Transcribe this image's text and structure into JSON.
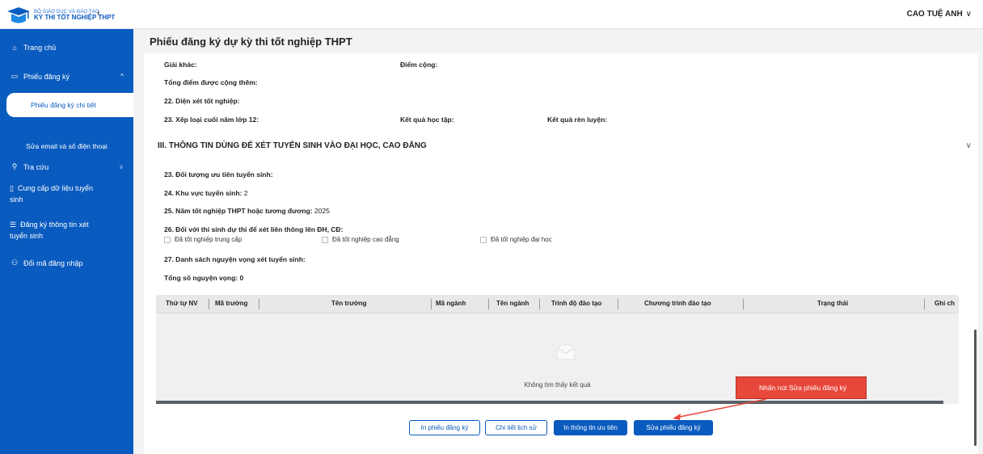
{
  "header": {
    "org_line": "BỘ GIÁO DỤC VÀ ĐÀO TẠO",
    "app_name": "KỲ THI TỐT NGHIỆP THPT",
    "collapse_glyph": "‹",
    "user_name": "CAO TUỆ ANH",
    "user_chevron": "∨"
  },
  "sidebar": {
    "home": {
      "icon": "⌂",
      "label": "Trang chủ"
    },
    "registration": {
      "icon": "▭",
      "label": "Phiếu đăng ký",
      "caret": "^"
    },
    "registration_detail": "Phiếu đăng ký chi tiết",
    "edit_contact": "Sửa email và số điện thoại",
    "lookup": {
      "icon": "⚲",
      "label": "Tra cứu",
      "caret": "∨"
    },
    "provide_data": {
      "icon": "▯",
      "label_1": "Cung cấp dữ liệu tuyển",
      "label_2": "sinh"
    },
    "register_info": {
      "icon": "☰",
      "label_1": "Đăng ký thông tin xét",
      "label_2": "tuyển sinh"
    },
    "change_code": {
      "icon": "⚇",
      "label": "Đổi mã đăng nhập"
    }
  },
  "main": {
    "title": "Phiếu đăng ký dự kỳ thi tốt nghiệp THPT",
    "fields": {
      "other_award": "Giải khác:",
      "bonus": "Điểm cộng:",
      "total_bonus": "Tổng điểm được cộng thêm:",
      "graduation_type": "22. Diện xét tốt nghiệp:",
      "grade12": "23. Xếp loại cuối năm lớp 12:",
      "academic": "Kết quả học tập:",
      "conduct": "Kết quả rèn luyện:"
    },
    "section3": {
      "title": "III. THÔNG TIN DÙNG ĐỂ XÉT TUYỂN SINH VÀO ĐẠI HỌC, CAO ĐẲNG",
      "chevron": "∨",
      "priority_label": "23. Đối tượng ưu tiên tuyển sinh:",
      "area_label": "24. Khu vực tuyển sinh:",
      "area_value": "2",
      "year_label": "25. Năm tốt nghiệp THPT hoặc tương đương:",
      "year_value": "2025",
      "transfer_label": "26. Đối với thí sinh dự thi để xét liên thông lên ĐH, CĐ:",
      "checkboxes": [
        "Đã tốt nghiệp trung cấp",
        "Đã tốt nghiệp cao đẳng",
        "Đã tốt nghiệp đại học"
      ],
      "wishes_label": "27. Danh sách nguyện vọng xét tuyển sinh:",
      "total_wishes": "Tổng số nguyện vọng: 0"
    },
    "table": {
      "columns": [
        "Thứ tự NV",
        "Mã trường",
        "Tên trường",
        "Mã ngành",
        "Tên ngành",
        "Trình độ đào tạo",
        "Chương trình đào tạo",
        "Trạng thái",
        "Ghi ch"
      ],
      "empty_text": "Không tìm thấy kết quả"
    },
    "buttons": {
      "print": "In phiếu đăng ký",
      "history": "Chi tiết lịch sử",
      "print_priority": "In thông tin ưu tiên",
      "edit": "Sửa phiếu đăng ký"
    },
    "callout": "Nhấn nút Sửa phiếu đăng ký"
  },
  "colors": {
    "primary": "#0a5bbf",
    "callout": "#e8473b"
  }
}
